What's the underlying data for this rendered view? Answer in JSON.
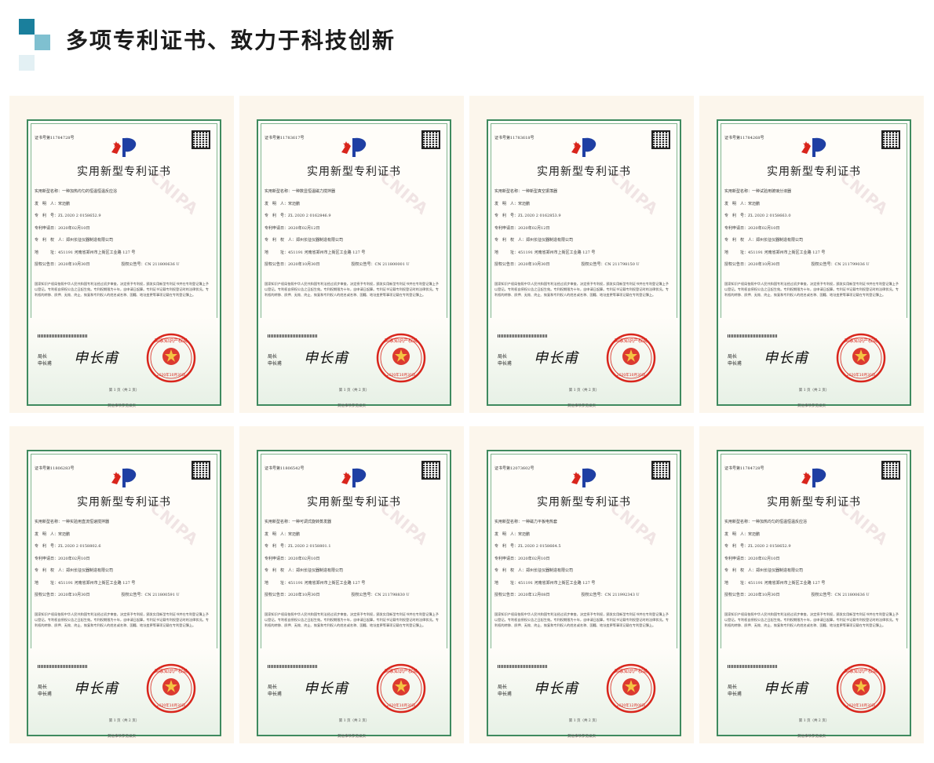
{
  "header": {
    "title": "多项专利证书、致力于科技创新"
  },
  "colors": {
    "accent_dark": "#1a7f9c",
    "accent_light": "#7fc0d0",
    "border_green": "#3f8a5f",
    "seal_red": "#d9251c"
  },
  "certificate_common": {
    "cert_title": "实用新型专利证书",
    "watermark": "CNIPA",
    "director_label": "局长",
    "director_label2": "申长甫",
    "signature": "申长甫",
    "seal_text": "国家知识产权局",
    "seal_date": "2020年10月30日",
    "page_no": "第 1 页（共 2 页）",
    "footer": "其他事项参见续页",
    "inventor_label": "发　明　人：宋迈鹏",
    "patentee_label": "专　利　权　人：郑州长征仪器制造有限公司",
    "address_label": "地　　　址：451191 河南省郑州市上街区工业路 127 号",
    "paragraph": "国家知识产权局依照中华人民共和国专利法经过初步审查，决定授予专利权，颁发实用新型专利证书并在专利登记簿上予以登记。专利权自授权公告之日起生效。专利权期限为十年，自申请日起算。专利证书记载专利权登记时的法律状况。专利权的转移、质押、无效、终止、恢复和专利权人的姓名或名称、国籍、地址变更等事项记载在专利登记簿上。"
  },
  "certificates": [
    {
      "cert_no": "证书号第11784728号",
      "name": "实用新型名称：一种加热均匀的恒温恒温反应浴",
      "patent_no": "专　利　号：ZL 2020 2 0158652.9",
      "app_date": "专利申请日：2020年02月10日",
      "grant_date": "授权公告日：2020年10月30日",
      "grant_no": "授权公告号：CN 211800636 U"
    },
    {
      "cert_no": "证书号第11783617号",
      "name": "实用新型名称：一种数显恒温磁力搅拌器",
      "patent_no": "专　利　号：ZL 2020 2 0162846.9",
      "app_date": "专利申请日：2020年02月12日",
      "grant_date": "授权公告日：2020年10月30日",
      "grant_no": "授权公告号：CN 211800001 U"
    },
    {
      "cert_no": "证书号第11783618号",
      "name": "实用新型名称：一种新型真空振荡器",
      "patent_no": "专　利　号：ZL 2020 2 0162853.9",
      "app_date": "专利申请日：2020年02月12日",
      "grant_date": "授权公告日：2020年10月30日",
      "grant_no": "授权公告号：CN 211798150 U"
    },
    {
      "cert_no": "证书号第11784268号",
      "name": "实用新型名称：一种试验用玻璃分液器",
      "patent_no": "专　利　号：ZL 2020 2 0158663.0",
      "app_date": "专利申请日：2020年02月10日",
      "grant_date": "授权公告日：2020年10月30日",
      "grant_no": "授权公告号：CN 211799036 U"
    },
    {
      "cert_no": "证书号第11806283号",
      "name": "实用新型名称：一种实验用直流恒速搅拌器",
      "patent_no": "专　利　号：ZL 2020 2 0158802.6",
      "app_date": "专利申请日：2020年02月10日",
      "grant_date": "授权公告日：2020年10月30日",
      "grant_no": "授权公告号：CN 211800591 U"
    },
    {
      "cert_no": "证书号第11806542号",
      "name": "实用新型名称：一种可调式旋转蒸发器",
      "patent_no": "专　利　号：ZL 2020 2 0158801.1",
      "app_date": "专利申请日：2020年02月10日",
      "grant_date": "授权公告日：2020年10月30日",
      "grant_no": "授权公告号：CN 211798830 U"
    },
    {
      "cert_no": "证书号第12073602号",
      "name": "实用新型名称：一种磁力平板电热套",
      "patent_no": "专　利　号：ZL 2020 2 0158664.5",
      "app_date": "专利申请日：2020年02月10日",
      "grant_date": "授权公告日：2020年12月08日",
      "grant_no": "授权公告号：CN 211992343 U"
    },
    {
      "cert_no": "证书号第11784728号",
      "name": "实用新型名称：一种加热均匀的恒温恒温反应浴",
      "patent_no": "专　利　号：ZL 2020 2 0158652.9",
      "app_date": "专利申请日：2020年02月10日",
      "grant_date": "授权公告日：2020年10月30日",
      "grant_no": "授权公告号：CN 211800636 U"
    }
  ]
}
